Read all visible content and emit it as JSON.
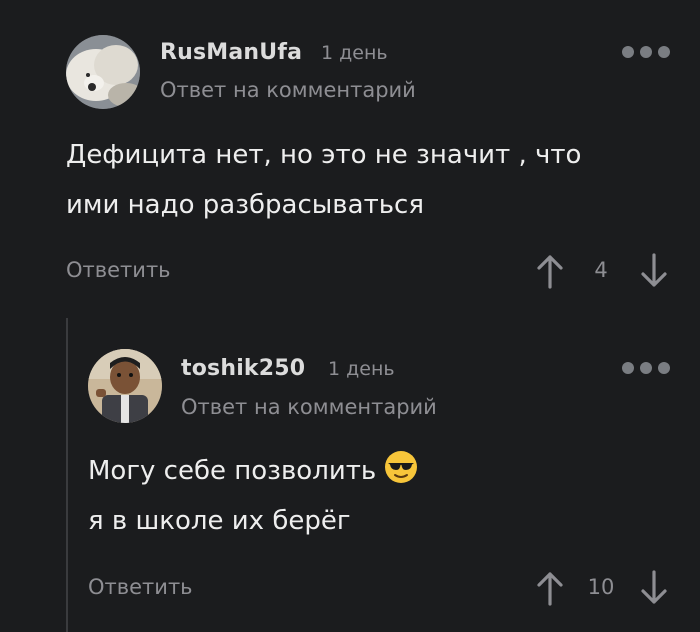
{
  "comments": [
    {
      "username": "RusManUfa",
      "time": "1 день",
      "reply_to": "Ответ на комментарий",
      "lines": [
        "Дефицита нет, но это не значит , что",
        "ими надо разбрасываться"
      ],
      "reply_label": "Ответить",
      "score": "4",
      "avatar_icon": "polar-bear-cub-avatar"
    },
    {
      "username": "toshik250",
      "time": "1 день",
      "reply_to": "Ответ на комментарий",
      "lines": [
        "Могу себе позволить",
        "я в школе их берёг"
      ],
      "emoji": "sunglasses-emoji",
      "reply_label": "Ответить",
      "score": "10",
      "avatar_icon": "boy-in-uniform-avatar"
    }
  ],
  "colors": {
    "background": "#1b1c1e",
    "text": "#eeeeee",
    "muted": "#8e8e93",
    "thread_line": "#3a3b3e"
  }
}
